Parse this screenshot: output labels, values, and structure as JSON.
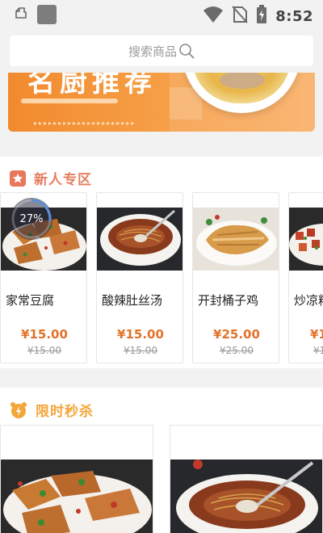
{
  "status_bar": {
    "time": "8:52",
    "icons": [
      "notification-icon",
      "app-square-icon",
      "wifi-icon",
      "no-sim-icon",
      "battery-charging-icon"
    ]
  },
  "search": {
    "placeholder": "搜索商品",
    "icon": "search-icon"
  },
  "banner": {
    "title": "名厨推荐"
  },
  "sections": {
    "new_user": {
      "title": "新人专区",
      "icon": "star-badge-icon",
      "products": [
        {
          "name": "家常豆腐",
          "price": "¥15.00",
          "original_price": "¥15.00",
          "progress_text": "27%",
          "progress": 0.27
        },
        {
          "name": "酸辣肚丝汤",
          "price": "¥15.00",
          "original_price": "¥15.00"
        },
        {
          "name": "开封桶子鸡",
          "price": "¥25.00",
          "original_price": "¥25.00"
        },
        {
          "name": "炒凉粉",
          "price": "¥1",
          "original_price": "¥1"
        }
      ]
    },
    "flash_sale": {
      "title": "限时秒杀",
      "icon": "alarm-clock-icon"
    }
  },
  "colors": {
    "accent_orange": "#e2722a",
    "section_title_new": "#e67e5f",
    "section_title_flash": "#f3a63a",
    "background": "#f2f2f2"
  }
}
